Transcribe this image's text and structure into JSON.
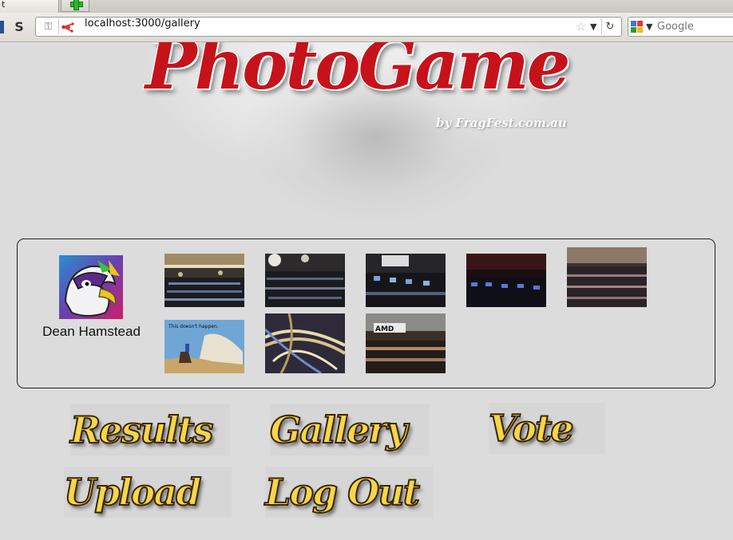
{
  "browser": {
    "tab_title": "t",
    "url": "localhost:3000/gallery",
    "search_placeholder": "Google"
  },
  "header": {
    "logo": "PhotoGame",
    "byline": "by FragFest.com.au"
  },
  "gallery": {
    "user_name": "Dean Hamstead",
    "thumbnails": [
      {
        "name": "lan-hall-photo-1"
      },
      {
        "name": "lan-hall-photo-2"
      },
      {
        "name": "lan-hall-photo-3"
      },
      {
        "name": "lan-hall-photo-4"
      },
      {
        "name": "lan-hall-photo-5"
      },
      {
        "name": "this-doesnt-happen-photo",
        "caption": "This doesn't happen."
      },
      {
        "name": "network-cables-photo"
      },
      {
        "name": "amd-banner-hall-photo",
        "caption": "AMD"
      }
    ]
  },
  "nav": {
    "results": "Results",
    "gallery": "Gallery",
    "vote": "Vote",
    "upload": "Upload",
    "logout": "Log Out"
  },
  "colors": {
    "logo_red": "#c6121b",
    "button_gold": "#f6d64a",
    "page_bg": "#dcdcdc"
  }
}
